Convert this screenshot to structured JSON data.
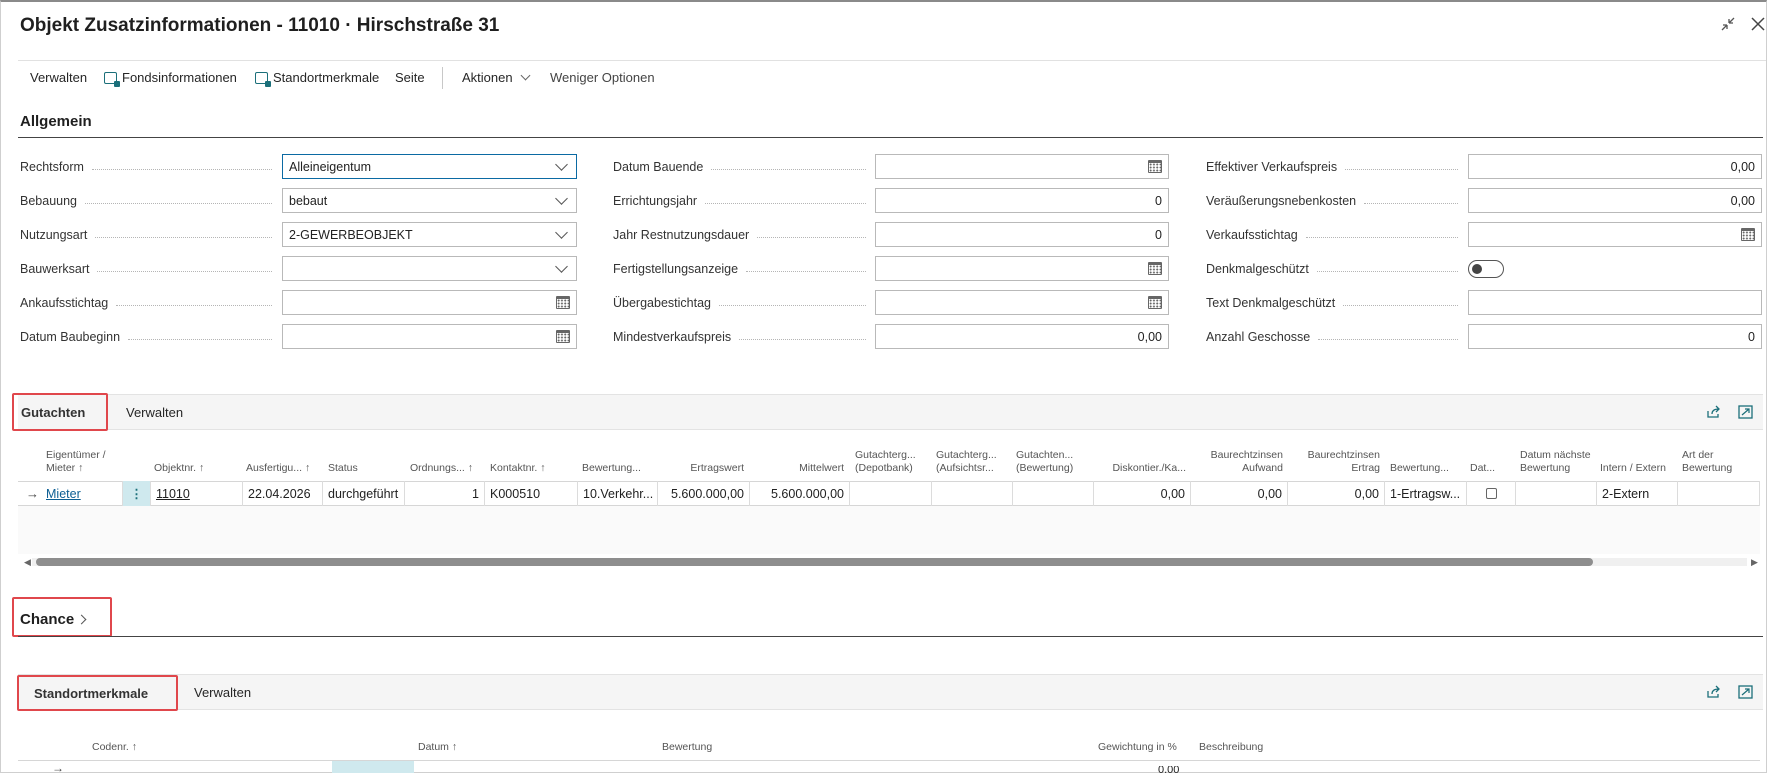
{
  "window": {
    "title": "Objekt Zusatzinformationen - 11010 · Hirschstraße 31"
  },
  "toolbar": {
    "verwalten": "Verwalten",
    "fondsinformationen": "Fondsinformationen",
    "standortmerkmale": "Standortmerkmale",
    "seite": "Seite",
    "aktionen": "Aktionen",
    "weniger_optionen": "Weniger Optionen"
  },
  "allgemein": {
    "title": "Allgemein",
    "col1": [
      {
        "label": "Rechtsform",
        "value": "Alleineigentum",
        "kind": "select"
      },
      {
        "label": "Bebauung",
        "value": "bebaut",
        "kind": "select"
      },
      {
        "label": "Nutzungsart",
        "value": "2-GEWERBEOBJEKT",
        "kind": "select"
      },
      {
        "label": "Bauwerksart",
        "value": "",
        "kind": "select"
      },
      {
        "label": "Ankaufsstichtag",
        "value": "",
        "kind": "date"
      },
      {
        "label": "Datum Baubeginn",
        "value": "",
        "kind": "date"
      }
    ],
    "col2": [
      {
        "label": "Datum Bauende",
        "value": "",
        "kind": "date"
      },
      {
        "label": "Errichtungsjahr",
        "value": "0",
        "kind": "number"
      },
      {
        "label": "Jahr Restnutzungsdauer",
        "value": "0",
        "kind": "number"
      },
      {
        "label": "Fertigstellungsanzeige",
        "value": "",
        "kind": "date"
      },
      {
        "label": "Übergabestichtag",
        "value": "",
        "kind": "date"
      },
      {
        "label": "Mindestverkaufspreis",
        "value": "0,00",
        "kind": "number"
      }
    ],
    "col3": [
      {
        "label": "Effektiver Verkaufspreis",
        "value": "0,00",
        "kind": "number"
      },
      {
        "label": "Veräußerungsnebenkosten",
        "value": "0,00",
        "kind": "number"
      },
      {
        "label": "Verkaufsstichtag",
        "value": "",
        "kind": "date"
      },
      {
        "label": "Denkmalgeschützt",
        "value": "",
        "kind": "toggle"
      },
      {
        "label": "Text Denkmalgeschützt",
        "value": "",
        "kind": "text"
      },
      {
        "label": "Anzahl Geschosse",
        "value": "0",
        "kind": "number"
      }
    ]
  },
  "gutachten": {
    "tab": "Gutachten",
    "manage": "Verwalten",
    "headers": [
      "Eigentümer / Mieter ↑",
      "Objektnr. ↑",
      "Ausfertigu... ↑",
      "Status",
      "Ordnungs... ↑",
      "Kontaktnr. ↑",
      "Bewertung...",
      "Ertragswert",
      "Mittelwert",
      "Gutachterg... (Depotbank)",
      "Gutachterg... (Aufsichtsr...",
      "Gutachten... (Bewertung)",
      "Diskontier./Ka...",
      "Baurechtzinsen Aufwand",
      "Baurechtzinsen Ertrag",
      "Bewertung...",
      "Dat...",
      "Datum nächste Bewertung",
      "Intern / Extern",
      "Art der Bewertung"
    ],
    "row": {
      "eigentuemer": "Mieter",
      "objektnr": "11010",
      "ausfertigung": "22.04.2026",
      "status": "durchgeführt",
      "ordnung": "1",
      "kontaktnr": "K000510",
      "bewertung": "10.Verkehr...",
      "ertragswert": "5.600.000,00",
      "mittelwert": "5.600.000,00",
      "diskont": "0,00",
      "br_aufwand": "0,00",
      "br_ertrag": "0,00",
      "bewertung2": "1-Ertragsw...",
      "intern_extern": "2-Extern"
    }
  },
  "chance": {
    "title": "Chance"
  },
  "standort": {
    "tab": "Standortmerkmale",
    "manage": "Verwalten",
    "headers": [
      "Codenr. ↑",
      "Datum ↑",
      "Bewertung",
      "Gewichtung in %",
      "Beschreibung"
    ],
    "partial_value": "0,00"
  },
  "colors": {
    "accent": "#0b6aa3",
    "teal": "#1b6f7a",
    "highlight_box": "#e0474c",
    "menu_cell": "#cfe9ee"
  }
}
